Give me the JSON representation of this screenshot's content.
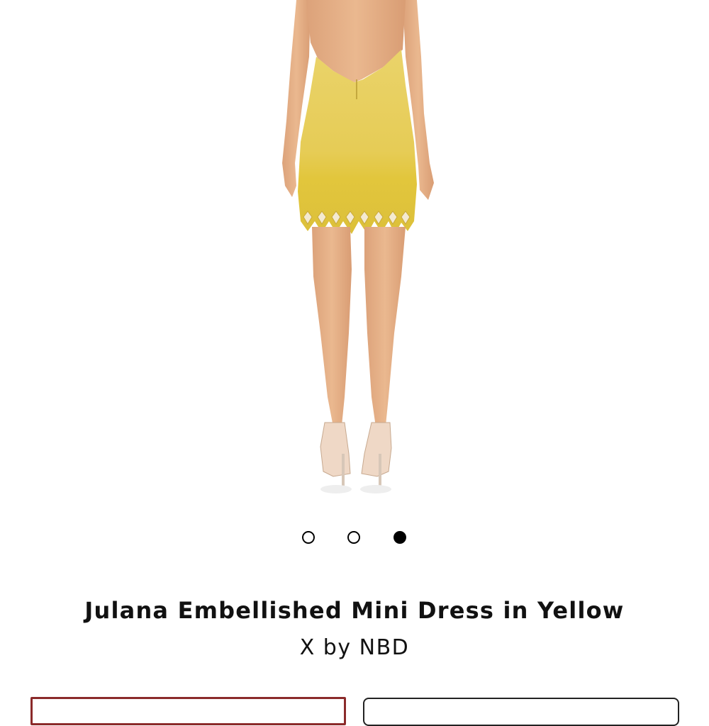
{
  "product": {
    "title": "Julana Embellished Mini Dress in Yellow",
    "brand": "X by NBD",
    "image": {
      "description_icon": "product-photo",
      "dress_color": "#e9cf4e",
      "skin_color": "#e9b489"
    }
  },
  "carousel": {
    "total": 3,
    "active_index": 2
  },
  "colors": {
    "active_dot": "#000000",
    "selector_border": "#8b2a2a"
  }
}
